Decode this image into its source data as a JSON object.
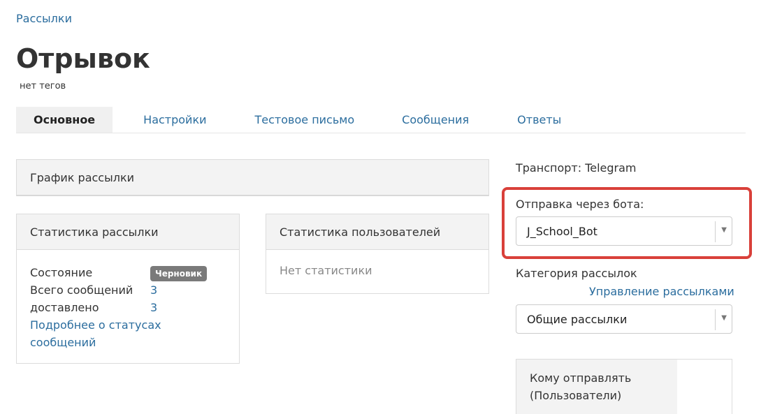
{
  "breadcrumb": "Рассылки",
  "title": "Отрывок",
  "tags": "нет тегов",
  "tabs": [
    {
      "label": "Основное",
      "active": true
    },
    {
      "label": "Настройки",
      "active": false
    },
    {
      "label": "Тестовое письмо",
      "active": false
    },
    {
      "label": "Сообщения",
      "active": false
    },
    {
      "label": "Ответы",
      "active": false
    }
  ],
  "schedule": {
    "title": "График рассылки"
  },
  "mailing_stats": {
    "title": "Статистика рассылки",
    "state_label": "Состояние",
    "state_badge": "Черновик",
    "total_label": "Всего сообщений",
    "total_value": "3",
    "delivered_label": "доставлено",
    "delivered_value": "3",
    "details_link": "Подробнее о статусах сообщений"
  },
  "user_stats": {
    "title": "Статистика пользователей",
    "empty": "Нет статистики"
  },
  "sidebar": {
    "transport": "Транспорт: Telegram",
    "bot_label": "Отправка через бота:",
    "bot_value": "J_School_Bot",
    "category_label": "Категория рассылок",
    "manage_link": "Управление рассылками",
    "category_value": "Общие рассылки",
    "recipients_title": "Кому отправлять (Пользователи)"
  },
  "colors": {
    "link": "#2b6d9e",
    "highlight": "#d9403a",
    "badge": "#7a7a7a"
  }
}
